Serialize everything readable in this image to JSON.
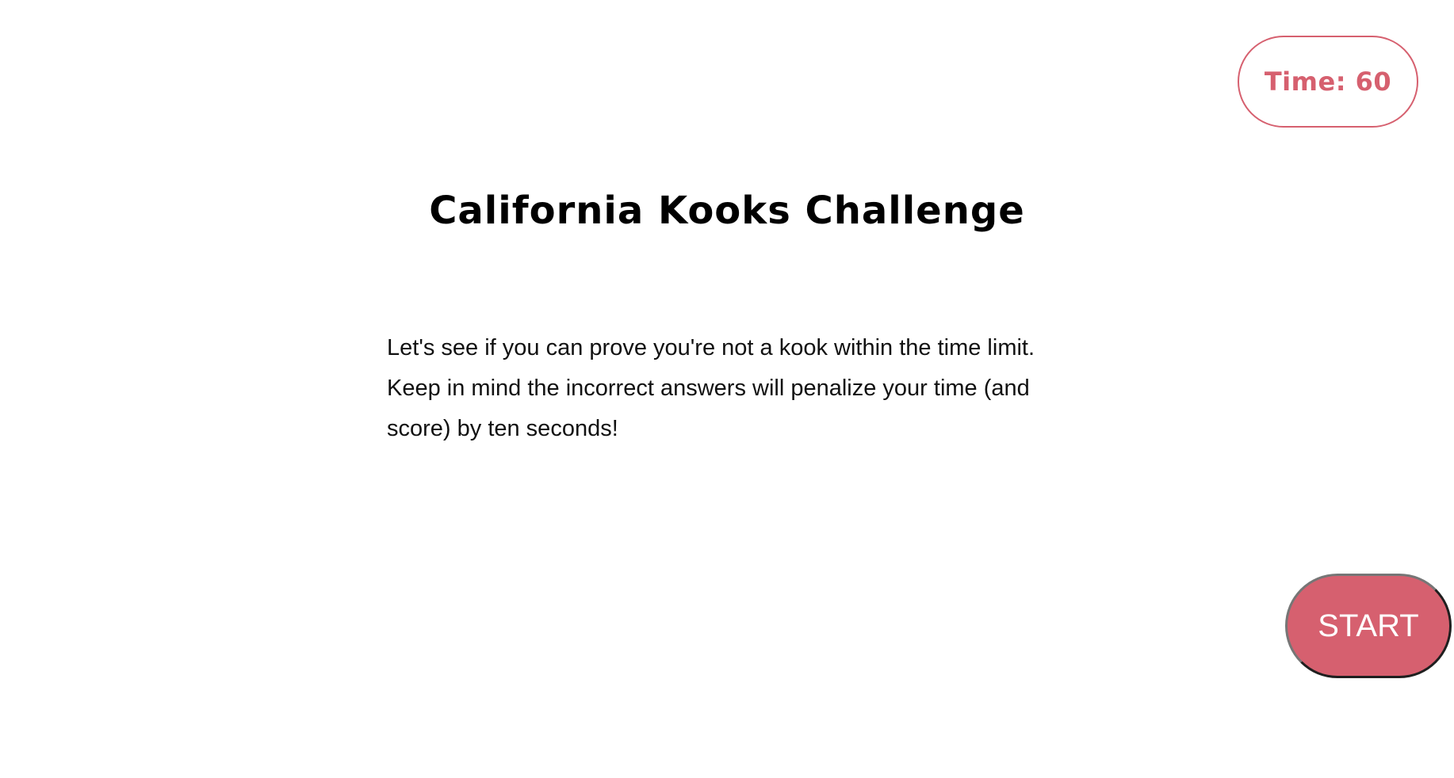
{
  "timer": {
    "label": "Time: 60"
  },
  "title": "California Kooks Challenge",
  "intro": {
    "text": "Let's see if you can prove you're not a kook within the time limit. Keep in mind the incorrect answers will penalize your time (and score) by ten seconds!"
  },
  "start_button": {
    "label": "START"
  },
  "colors": {
    "accent": "#d6606f",
    "text": "#000000",
    "background": "#ffffff",
    "button_text": "#ffffff"
  }
}
